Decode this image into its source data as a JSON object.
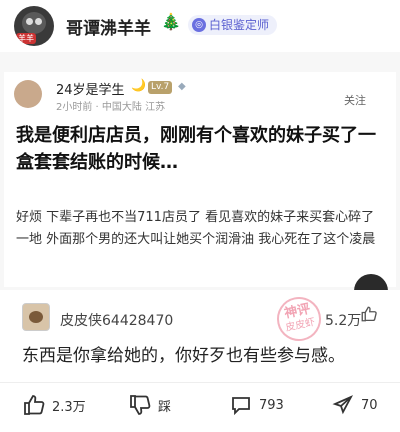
{
  "header": {
    "username": "哥谭沸羊羊",
    "avatar_tag": "羊羊",
    "tree_icon": "🎄",
    "badge_icon": "◎",
    "badge_text": "白银鉴定师"
  },
  "post": {
    "username": "24岁是学生",
    "moon": "🌙",
    "level": "Lv.7",
    "gem": "◆",
    "meta": "2小时前 · 中国大陆 江苏",
    "follow_label": "关注",
    "title": "我是便利店店员，刚刚有个喜欢的妹子买了一盒套套结账的时候…",
    "body": "好烦 下辈子再也不当711店员了 看见喜欢的妹子来买套心碎了一地 外面那个男的还大叫让她买个润滑油 我心死在了这个凌晨"
  },
  "comment": {
    "username": "皮皮侠64428470",
    "likes": "5.2万",
    "text": "东西是你拿给她的，你好歹也有些参与感。",
    "stamp_line1": "神评",
    "stamp_line2": "皮皮虾"
  },
  "actions": {
    "like": "2.3万",
    "dislike": "踩",
    "comments": "793",
    "share": "70"
  },
  "colors": {
    "badge_accent": "#5a5fd0",
    "stamp": "#f2a4b4"
  }
}
